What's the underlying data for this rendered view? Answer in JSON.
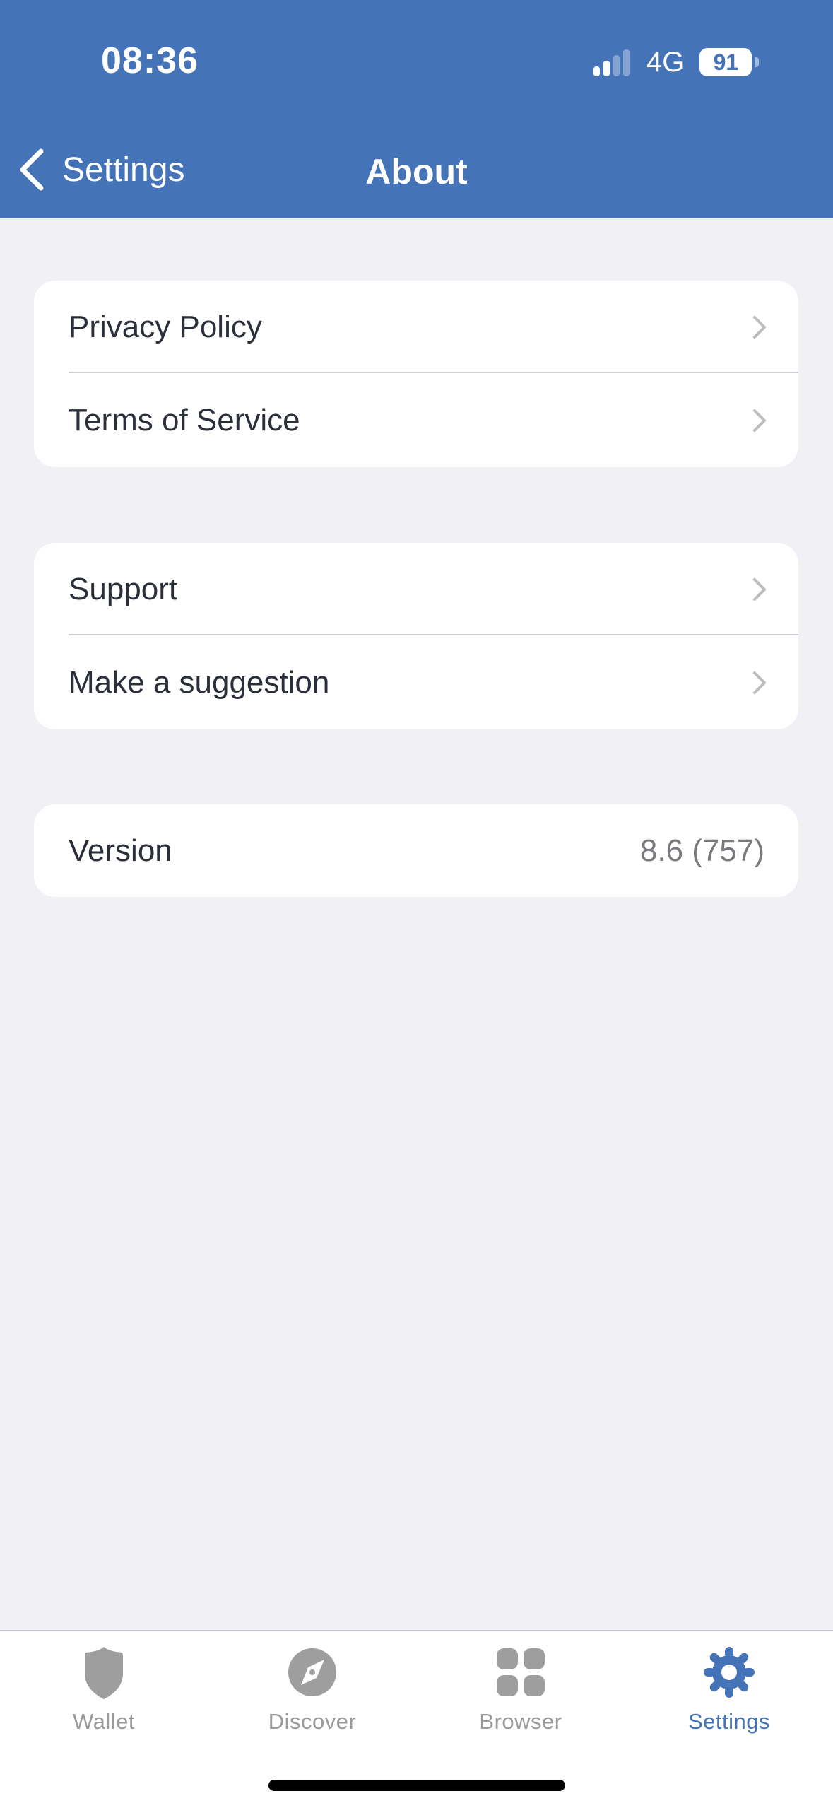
{
  "status_bar": {
    "time": "08:36",
    "network": "4G",
    "signal_bars_active": 2,
    "signal_bars_total": 4,
    "battery_percent": "91"
  },
  "nav": {
    "back_label": "Settings",
    "title": "About"
  },
  "groups": [
    {
      "items": [
        {
          "label": "Privacy Policy"
        },
        {
          "label": "Terms of Service"
        }
      ]
    },
    {
      "items": [
        {
          "label": "Support"
        },
        {
          "label": "Make a suggestion"
        }
      ]
    },
    {
      "items": [
        {
          "label": "Version",
          "value": "8.6 (757)"
        }
      ]
    }
  ],
  "tabbar": {
    "tabs": [
      {
        "label": "Wallet",
        "icon": "shield-icon",
        "active": false
      },
      {
        "label": "Discover",
        "icon": "compass-icon",
        "active": false
      },
      {
        "label": "Browser",
        "icon": "grid-icon",
        "active": false
      },
      {
        "label": "Settings",
        "icon": "gear-icon",
        "active": true
      }
    ]
  },
  "colors": {
    "accent": "#4573B7",
    "background": "#F0F0F5",
    "inactive_tab": "#9B9B9B",
    "text": "#2B2F3A",
    "secondary_text": "#7A7A7E"
  }
}
